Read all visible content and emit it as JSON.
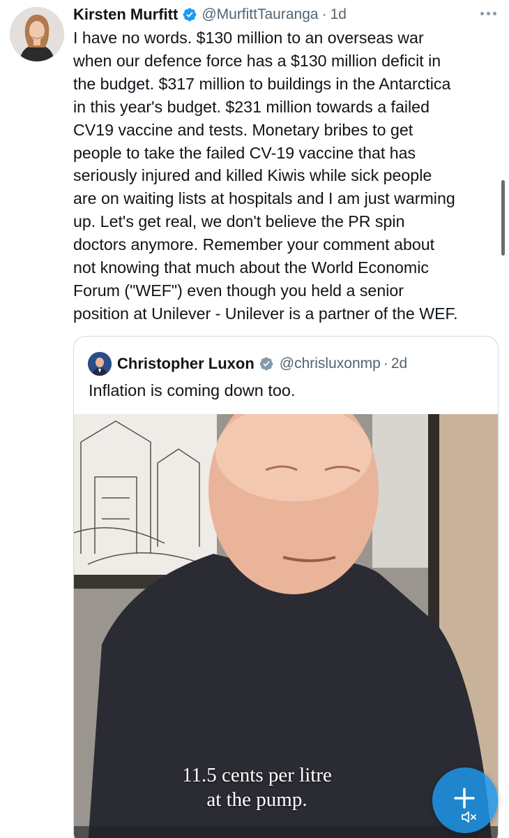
{
  "tweet": {
    "author": {
      "display_name": "Kirsten Murfitt",
      "handle": "@MurfittTauranga",
      "separator": "·",
      "time": "1d",
      "verified": true
    },
    "text": "I have no words. $130 million to an overseas war\nwhen our defence force has a $130 million deficit in\nthe budget. $317 million to buildings in the Antarctica\nin this year's budget. $231 million towards a failed\nCV19 vaccine and tests.  Monetary bribes to get\npeople to take the failed CV-19 vaccine that has\nseriously injured and killed Kiwis while sick people\nare on waiting lists at hospitals and I am just warming\nup.  Let's get real, we don't believe the PR spin\ndoctors anymore. Remember your comment about\nnot knowing that much about the World Economic\nForum (\"WEF\") even though you held a senior\nposition at Unilever - Unilever is a partner of the WEF.",
    "more_icon": "ellipsis-icon"
  },
  "quoted": {
    "author": {
      "display_name": "Christopher Luxon",
      "handle": "@chrisluxonmp",
      "separator": "·",
      "time": "2d",
      "verified": true
    },
    "text": "Inflation is coming down too.",
    "video_caption": "11.5 cents per litre\nat the pump."
  },
  "fab": {
    "icon": "plus-icon"
  },
  "video_controls": {
    "icon": "mute-icon"
  },
  "colors": {
    "text": "#0f1419",
    "secondary": "#536471",
    "verified": "#1d9bf0",
    "border": "#cfd9de",
    "fab": "#1d9bf0"
  }
}
